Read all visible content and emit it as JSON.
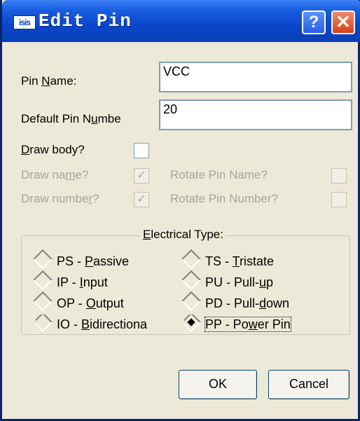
{
  "window": {
    "app_icon": "isis",
    "title": "Edit Pin",
    "help_label": "?",
    "close_label": "✕"
  },
  "fields": {
    "pin_name": {
      "label_pre": "Pin ",
      "label_u": "N",
      "label_post": "ame:",
      "value": "VCC"
    },
    "pin_number": {
      "label_pre": "Default Pin N",
      "label_u": "u",
      "label_post": "mbe",
      "value": "20"
    }
  },
  "checks": {
    "draw_body": {
      "label_pre": "",
      "label_u": "D",
      "label_post": "raw body?",
      "checked": false
    },
    "draw_name": {
      "label_pre": "Draw na",
      "label_u": "m",
      "label_post": "e?",
      "checked": true,
      "mark": "✓"
    },
    "draw_number": {
      "label_pre": "Draw numbe",
      "label_u": "r",
      "label_post": "?",
      "checked": true,
      "mark": "✓"
    },
    "rotate_name": {
      "label": "Rotate Pin Name?",
      "checked": false
    },
    "rotate_number": {
      "label": "Rotate Pin Number?",
      "checked": false
    }
  },
  "electrical": {
    "title_u": "E",
    "title_post": "lectrical Type:",
    "options": [
      {
        "pre": "PS - ",
        "u": "P",
        "post": "assive"
      },
      {
        "pre": "IP - ",
        "u": "I",
        "post": "nput"
      },
      {
        "pre": "OP - ",
        "u": "O",
        "post": "utput"
      },
      {
        "pre": "IO - ",
        "u": "B",
        "post": "idirectiona"
      },
      {
        "pre": "TS - ",
        "u": "T",
        "post": "ristate"
      },
      {
        "pre": "PU - Pull-",
        "u": "u",
        "post": "p"
      },
      {
        "pre": "PD - Pull-",
        "u": "d",
        "post": "own"
      },
      {
        "pre": "PP - Po",
        "u": "w",
        "post": "er Pin"
      }
    ],
    "selected": "PP - Power Pin"
  },
  "buttons": {
    "ok": "OK",
    "cancel": "Cancel"
  }
}
